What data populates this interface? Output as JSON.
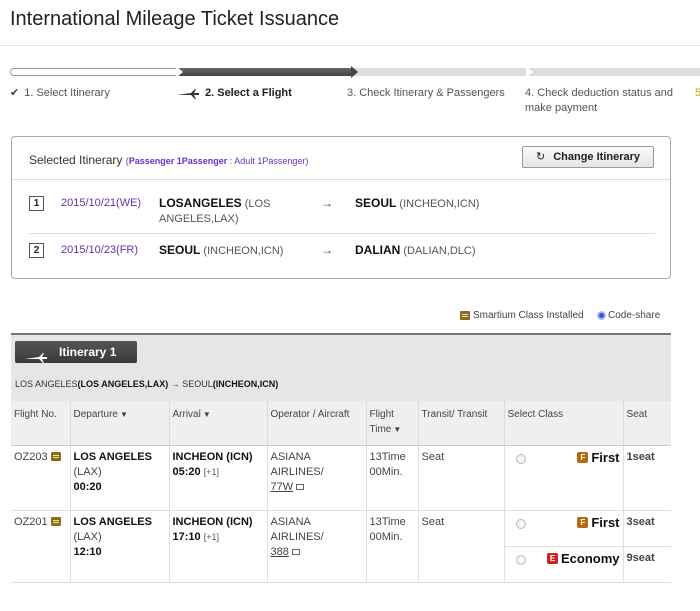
{
  "title": "International Mileage Ticket Issuance",
  "steps": [
    {
      "label": "1. Select Itinerary"
    },
    {
      "label": "2. Select a Flight"
    },
    {
      "label": "3. Check Itinerary & Passengers"
    },
    {
      "label": "4. Check deduction status and make payment"
    }
  ],
  "selected": {
    "heading": "Selected Itinerary",
    "pax_prefix": "(",
    "pax_strong": "Passenger 1Passenger",
    "pax_rest": " : Adult 1Passenger)",
    "change_button": "Change Itinerary",
    "rows": [
      {
        "num": "1",
        "date": "2015/10/21(WE)",
        "from_city": "LOSANGELES",
        "from_detail": " (LOS ANGELES,LAX)",
        "arrow": "→",
        "to_city": "SEOUL",
        "to_detail": " (INCHEON,ICN)"
      },
      {
        "num": "2",
        "date": "2015/10/23(FR)",
        "from_city": "SEOUL",
        "from_detail": " (INCHEON,ICN)",
        "arrow": "→",
        "to_city": "DALIAN",
        "to_detail": " (DALIAN,DLC)"
      }
    ]
  },
  "legend": {
    "smartium": "Smartium Class Installed",
    "codeshare": "Code-share"
  },
  "itinerary": {
    "tab_label": "Itinerary 1",
    "route_from": "LOS ANGELES",
    "route_from_detail": "(LOS ANGELES,LAX)",
    "route_arrow": " → ",
    "route_to": "SEOUL",
    "route_to_detail": "(INCHEON,ICN)"
  },
  "table": {
    "headers": {
      "flight_no": "Flight No.",
      "departure": "Departure",
      "arrival": "Arrival",
      "operator": "Operator / Aircraft",
      "flight_time": "Flight Time",
      "transit": "Transit/ Transit",
      "select_class": "Select Class",
      "seat": "Seat"
    },
    "rows": [
      {
        "flight_no": "OZ203",
        "dep_city": "LOS ANGELES",
        "dep_code": "(LAX)",
        "dep_time": "00:20",
        "arr_city": "INCHEON (ICN)",
        "arr_time": "05:20",
        "arr_plus": "[+1]",
        "operator": "ASIANA AIRLINES/",
        "aircraft": "77W",
        "flight_time": "13Time 00Min.",
        "transit": "Seat",
        "classes": [
          {
            "badge": "F",
            "name": "First",
            "seat": "1seat"
          }
        ]
      },
      {
        "flight_no": "OZ201",
        "dep_city": "LOS ANGELES",
        "dep_code": "(LAX)",
        "dep_time": "12:10",
        "arr_city": "INCHEON (ICN)",
        "arr_time": "17:10",
        "arr_plus": "[+1]",
        "operator": "ASIANA AIRLINES/",
        "aircraft": "388",
        "flight_time": "13Time 00Min.",
        "transit": "Seat",
        "classes": [
          {
            "badge": "F",
            "name": "First",
            "seat": "3seat"
          },
          {
            "badge": "E",
            "name": "Economy",
            "seat": "9seat"
          }
        ]
      }
    ]
  },
  "colors": {
    "accent_purple": "#6633aa",
    "first_badge": "#b86a12",
    "economy_badge": "#cc2222",
    "step_active": "#444444"
  }
}
